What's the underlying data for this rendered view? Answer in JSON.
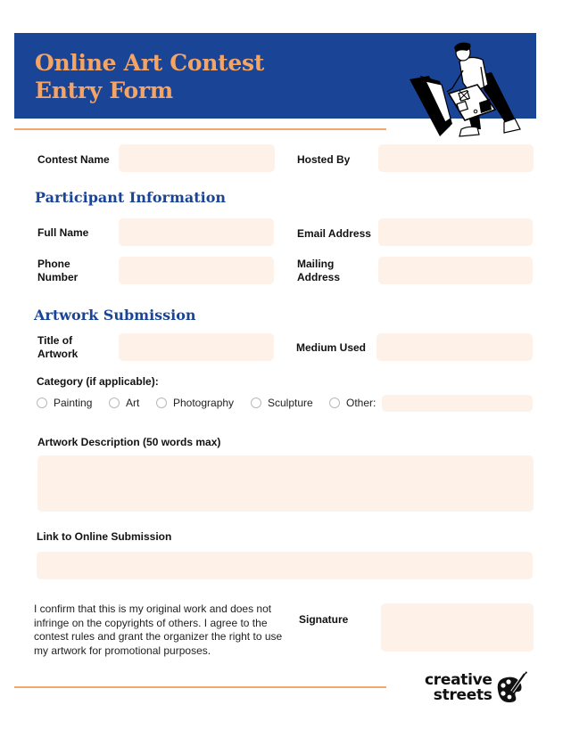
{
  "header": {
    "title_line1": "Online Art Contest",
    "title_line2": "Entry Form",
    "illustration": "person-carrying-artwork-illustration"
  },
  "contest": {
    "contest_name_label": "Contest Name",
    "contest_name_value": "",
    "hosted_by_label": "Hosted By",
    "hosted_by_value": ""
  },
  "participant": {
    "section_title": "Participant Information",
    "full_name_label": "Full Name",
    "full_name_value": "",
    "email_label": "Email Address",
    "email_value": "",
    "phone_label_line1": "Phone",
    "phone_label_line2": "Number",
    "phone_value": "",
    "mailing_label_line1": "Mailing",
    "mailing_label_line2": "Address",
    "mailing_value": ""
  },
  "artwork": {
    "section_title": "Artwork Submission",
    "title_label_line1": "Title of",
    "title_label_line2": "Artwork",
    "title_value": "",
    "medium_label": "Medium Used",
    "medium_value": "",
    "category_label": "Category (if applicable):",
    "categories": [
      {
        "label": "Painting",
        "checked": false
      },
      {
        "label": "Art",
        "checked": false
      },
      {
        "label": "Photography",
        "checked": false
      },
      {
        "label": "Sculpture",
        "checked": false
      },
      {
        "label": "Other:",
        "checked": false
      }
    ],
    "other_value": "",
    "description_label": "Artwork Description (50 words max)",
    "description_value": "",
    "link_label": "Link to Online Submission",
    "link_value": ""
  },
  "consent": {
    "text": "I confirm that this is my original work and does not infringe on the copyrights of others. I agree to the contest rules and grant the organizer the right to use my artwork for promotional purposes.",
    "signature_label": "Signature",
    "signature_value": ""
  },
  "branding": {
    "logo_line1": "creative",
    "logo_line2": "streets",
    "logo_icon": "palette-brush-icon"
  },
  "colors": {
    "header_blue": "#1a4597",
    "title_orange": "#f4a464",
    "divider_orange": "#f2a86a",
    "field_fill": "#fdf1e8",
    "section_blue": "#1a4597"
  }
}
